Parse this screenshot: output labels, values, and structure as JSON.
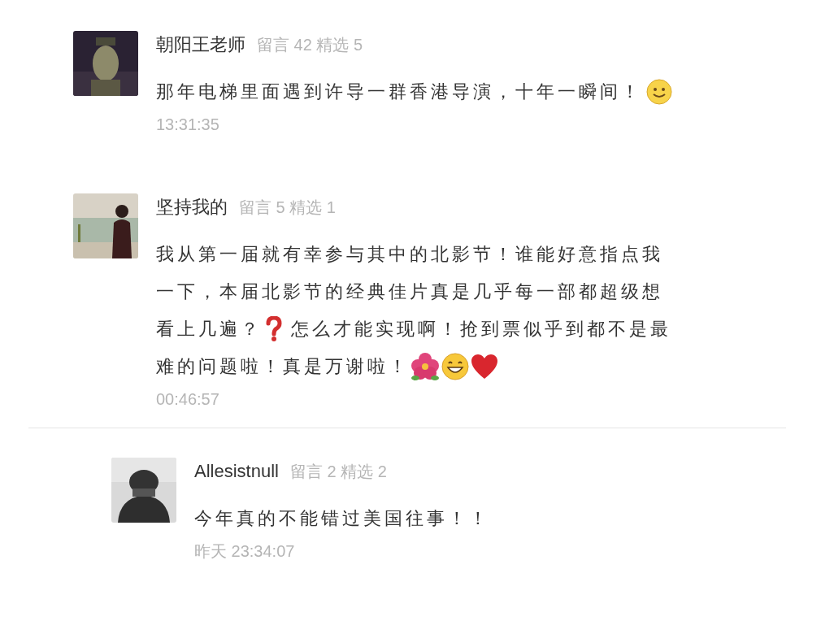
{
  "sections": [
    {
      "comments": [
        {
          "name": "朝阳王老师",
          "meta": "留言 42 精选 5",
          "avatar": {
            "kind": "picture"
          },
          "lines": [
            [
              {
                "kind": "text",
                "text": "那年电梯里面遇到许导一群香港导演，十年一瞬间！"
              },
              {
                "kind": "smile"
              }
            ]
          ],
          "time": "13:31:35"
        },
        {
          "name": "坚持我的",
          "meta": "留言 5 精选 1",
          "avatar": {
            "kind": "picture"
          },
          "lines": [
            [
              {
                "kind": "text",
                "text": "我从第一届就有幸参与其中的北影节！谁能好意指点我"
              }
            ],
            [
              {
                "kind": "text",
                "text": "一下，本届北影节的经典佳片真是几乎每一部都超级想"
              }
            ],
            [
              {
                "kind": "text",
                "text": "看上几遍？"
              },
              {
                "kind": "question"
              },
              {
                "kind": "text",
                "text": "怎么才能实现啊！抢到票似乎到都不是最"
              }
            ],
            [
              {
                "kind": "text",
                "text": "难的问题啦！真是万谢啦！"
              },
              {
                "kind": "flower"
              },
              {
                "kind": "grin"
              },
              {
                "kind": "heart"
              }
            ]
          ],
          "time": "00:46:57"
        }
      ]
    },
    {
      "comments": [
        {
          "name": "Allesistnull",
          "meta": "留言 2 精选 2",
          "avatar": {
            "kind": "picture"
          },
          "lines": [
            [
              {
                "kind": "text",
                "text": "今年真的不能错过美国往事！！"
              }
            ]
          ],
          "time": "昨天 23:34:07"
        }
      ]
    }
  ]
}
